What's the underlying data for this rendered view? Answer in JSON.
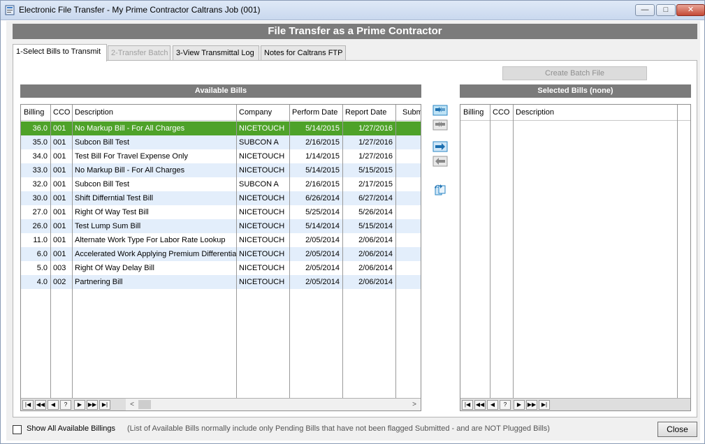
{
  "window": {
    "title": "Electronic File Transfer - My Prime Contractor Caltrans Job (001)",
    "controls": {
      "minimize": "—",
      "maximize": "□",
      "close": "✕"
    }
  },
  "banner": "File Transfer as a Prime Contractor",
  "tabs": [
    {
      "label": "1-Select Bills to Transmit",
      "state": "active"
    },
    {
      "label": "2-Transfer Batch",
      "state": "disabled"
    },
    {
      "label": "3-View Transmittal Log",
      "state": "normal"
    },
    {
      "label": "Notes for Caltrans FTP",
      "state": "normal"
    }
  ],
  "create_batch_label": "Create Batch File",
  "available": {
    "header": "Available Bills",
    "columns": [
      "Billing",
      "CCO",
      "Description",
      "Company",
      "Perform Date",
      "Report Date",
      "Subm"
    ],
    "rows": [
      [
        "36.0",
        "001",
        "No Markup Bill - For All Charges",
        "NICETOUCH",
        "5/14/2015",
        "1/27/2016"
      ],
      [
        "35.0",
        "001",
        "Subcon Bill Test",
        "SUBCON A",
        "2/16/2015",
        "1/27/2016"
      ],
      [
        "34.0",
        "001",
        "Test Bill For Travel Expense Only",
        "NICETOUCH",
        "1/14/2015",
        "1/27/2016"
      ],
      [
        "33.0",
        "001",
        "No Markup Bill - For All Charges",
        "NICETOUCH",
        "5/14/2015",
        "5/15/2015"
      ],
      [
        "32.0",
        "001",
        "Subcon Bill Test",
        "SUBCON A",
        "2/16/2015",
        "2/17/2015"
      ],
      [
        "30.0",
        "001",
        "Shift Differntial Test Bill",
        "NICETOUCH",
        "6/26/2014",
        "6/27/2014"
      ],
      [
        "27.0",
        "001",
        "Right Of Way Test Bill",
        "NICETOUCH",
        "5/25/2014",
        "5/26/2014"
      ],
      [
        "26.0",
        "001",
        "Test Lump Sum Bill",
        "NICETOUCH",
        "5/14/2014",
        "5/15/2014"
      ],
      [
        "11.0",
        "001",
        "Alternate Work Type For Labor Rate Lookup",
        "NICETOUCH",
        "2/05/2014",
        "2/06/2014"
      ],
      [
        "6.0",
        "001",
        "Accelerated Work Applying Premium Differential",
        "NICETOUCH",
        "2/05/2014",
        "2/06/2014"
      ],
      [
        "5.0",
        "003",
        "Right Of Way Delay Bill",
        "NICETOUCH",
        "2/05/2014",
        "2/06/2014"
      ],
      [
        "4.0",
        "002",
        "Partnering Bill",
        "NICETOUCH",
        "2/05/2014",
        "2/06/2014"
      ]
    ],
    "selected_row": 0
  },
  "selected": {
    "header": "Selected Bills (none)",
    "columns": [
      "Billing",
      "CCO",
      "Description"
    ]
  },
  "navigator": {
    "buttons": [
      "|◀",
      "◀◀",
      "◀",
      "?",
      "▶",
      "▶▶",
      "▶|"
    ],
    "scroll_left": "<",
    "scroll_right": ">"
  },
  "footer": {
    "checkbox_label": "Show All Available Billings",
    "checkbox_checked": false,
    "note": "(List of Available Bills normally include only Pending Bills that have not been flagged Submitted - and are NOT Plugged Bills)",
    "close_label": "Close"
  },
  "icons": {
    "app": "app-window-icon",
    "move_all_right": "move-all-right-icon",
    "move_all_left": "move-all-left-icon",
    "move_right": "move-right-icon",
    "move_left": "move-left-icon",
    "refresh": "refresh-copy-icon"
  },
  "colors": {
    "selected_row": "#4ea229",
    "alt_row": "#e3eefb",
    "header_bar": "#7b7b7b"
  }
}
